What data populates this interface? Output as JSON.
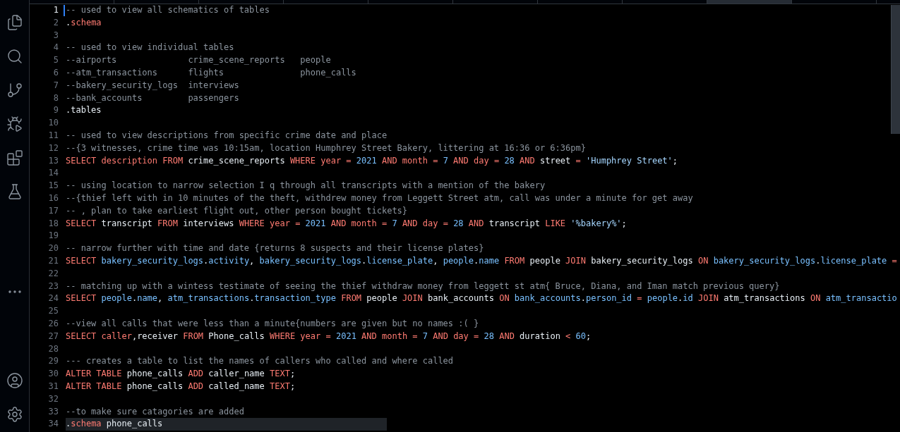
{
  "tabs": [
    {
      "selected": false
    },
    {
      "selected": false
    },
    {
      "selected": false
    },
    {
      "selected": false
    },
    {
      "selected": false
    },
    {
      "selected": false
    },
    {
      "selected": false
    },
    {
      "selected": false
    },
    {
      "selected": true
    },
    {
      "selected": false
    }
  ],
  "lines": [
    {
      "number": "1",
      "active": true,
      "tokens": [
        {
          "kind": "comment",
          "text": "-- used to view all schematics of tables"
        }
      ]
    },
    {
      "number": "2",
      "active": false,
      "tokens": [
        {
          "kind": "plain",
          "text": "."
        },
        {
          "kind": "keyword",
          "text": "schema"
        }
      ]
    },
    {
      "number": "3",
      "active": false
    },
    {
      "number": "4",
      "active": false,
      "tokens": [
        {
          "kind": "comment",
          "text": "-- used to view individual tables"
        }
      ]
    },
    {
      "number": "5",
      "active": false,
      "tokens": [
        {
          "kind": "comment",
          "text": "--airports              crime_scene_reports   people"
        }
      ]
    },
    {
      "number": "6",
      "active": false,
      "tokens": [
        {
          "kind": "comment",
          "text": "--atm_transactions      flights               phone_calls"
        }
      ]
    },
    {
      "number": "7",
      "active": false,
      "tokens": [
        {
          "kind": "comment",
          "text": "--bakery_security_logs  interviews"
        }
      ]
    },
    {
      "number": "8",
      "active": false,
      "tokens": [
        {
          "kind": "comment",
          "text": "--bank_accounts         passengers"
        }
      ]
    },
    {
      "number": "9",
      "active": false,
      "tokens": [
        {
          "kind": "plain",
          "text": ".tables"
        }
      ]
    },
    {
      "number": "10",
      "active": false
    },
    {
      "number": "11",
      "active": false,
      "tokens": [
        {
          "kind": "comment",
          "text": "-- used to view descriptions from specific crime date and place"
        }
      ]
    },
    {
      "number": "12",
      "active": false,
      "tokens": [
        {
          "kind": "comment",
          "text": "--{3 witnesses, crime time was 10:15am, location Humphrey Street Bakery, littering at 16:36 or 6:36pm}"
        }
      ]
    },
    {
      "number": "13",
      "active": false,
      "tokens": [
        {
          "kind": "keyword",
          "text": "SELECT description FROM "
        },
        {
          "kind": "plain",
          "text": "crime_scene_reports"
        },
        {
          "kind": "keyword",
          "text": " WHERE year = "
        },
        {
          "kind": "number",
          "text": "2021"
        },
        {
          "kind": "keyword",
          "text": " AND month = "
        },
        {
          "kind": "number",
          "text": "7"
        },
        {
          "kind": "keyword",
          "text": " AND day = "
        },
        {
          "kind": "number",
          "text": "28"
        },
        {
          "kind": "keyword",
          "text": " AND "
        },
        {
          "kind": "plain",
          "text": "street"
        },
        {
          "kind": "keyword",
          "text": " = "
        },
        {
          "kind": "string",
          "text": "'Humphrey Street'"
        },
        {
          "kind": "plain",
          "text": ";"
        }
      ]
    },
    {
      "number": "14",
      "active": false
    },
    {
      "number": "15",
      "active": false,
      "tokens": [
        {
          "kind": "comment",
          "text": "-- using location to narrow selection I q through all transcripts with a mention of the bakery"
        }
      ]
    },
    {
      "number": "16",
      "active": false,
      "tokens": [
        {
          "kind": "comment",
          "text": "--{thief left with in 10 minutes of the theft, withdrew money from Leggett Street atm, call was under a minute for get away"
        }
      ]
    },
    {
      "number": "17",
      "active": false,
      "tokens": [
        {
          "kind": "comment",
          "text": "-- , plan to take earliest flight out, other person bought tickets}"
        }
      ]
    },
    {
      "number": "18",
      "active": false,
      "tokens": [
        {
          "kind": "keyword",
          "text": "SELECT "
        },
        {
          "kind": "plain",
          "text": "transcript"
        },
        {
          "kind": "keyword",
          "text": " FROM "
        },
        {
          "kind": "plain",
          "text": "interviews"
        },
        {
          "kind": "keyword",
          "text": " WHERE year = "
        },
        {
          "kind": "number",
          "text": "2021"
        },
        {
          "kind": "keyword",
          "text": " AND month = "
        },
        {
          "kind": "number",
          "text": "7"
        },
        {
          "kind": "keyword",
          "text": " AND day = "
        },
        {
          "kind": "number",
          "text": "28"
        },
        {
          "kind": "keyword",
          "text": " AND "
        },
        {
          "kind": "plain",
          "text": "transcript"
        },
        {
          "kind": "keyword",
          "text": " LIKE "
        },
        {
          "kind": "string",
          "text": "'%bakery%'"
        },
        {
          "kind": "plain",
          "text": ";"
        }
      ]
    },
    {
      "number": "19",
      "active": false
    },
    {
      "number": "20",
      "active": false,
      "tokens": [
        {
          "kind": "comment",
          "text": "-- narrow further with time and date {returns 8 suspects and their license plates}"
        }
      ]
    },
    {
      "number": "21",
      "active": false,
      "tokens": [
        {
          "kind": "keyword",
          "text": "SELECT "
        },
        {
          "kind": "member",
          "text": "bakery_security_logs"
        },
        {
          "kind": "plain",
          "text": "."
        },
        {
          "kind": "member",
          "text": "activity"
        },
        {
          "kind": "plain",
          "text": ", "
        },
        {
          "kind": "member",
          "text": "bakery_security_logs"
        },
        {
          "kind": "plain",
          "text": "."
        },
        {
          "kind": "member",
          "text": "license_plate"
        },
        {
          "kind": "plain",
          "text": ", "
        },
        {
          "kind": "member",
          "text": "people"
        },
        {
          "kind": "plain",
          "text": "."
        },
        {
          "kind": "member",
          "text": "name"
        },
        {
          "kind": "keyword",
          "text": " FROM "
        },
        {
          "kind": "plain",
          "text": "people"
        },
        {
          "kind": "keyword",
          "text": " JOIN "
        },
        {
          "kind": "plain",
          "text": "bakery_security_logs"
        },
        {
          "kind": "keyword",
          "text": " ON "
        },
        {
          "kind": "member",
          "text": "bakery_security_logs"
        },
        {
          "kind": "plain",
          "text": "."
        },
        {
          "kind": "member",
          "text": "license_plate"
        },
        {
          "kind": "keyword",
          "text": " ="
        }
      ]
    },
    {
      "number": "22",
      "active": false
    },
    {
      "number": "23",
      "active": false,
      "tokens": [
        {
          "kind": "comment",
          "text": "-- matching up with a wintess testimate of seeing the thief withdraw money from leggett st atm{ Bruce, Diana, and Iman match previous query}"
        }
      ]
    },
    {
      "number": "24",
      "active": false,
      "tokens": [
        {
          "kind": "keyword",
          "text": "SELECT "
        },
        {
          "kind": "member",
          "text": "people"
        },
        {
          "kind": "plain",
          "text": "."
        },
        {
          "kind": "member",
          "text": "name"
        },
        {
          "kind": "plain",
          "text": ", "
        },
        {
          "kind": "member",
          "text": "atm_transactions"
        },
        {
          "kind": "plain",
          "text": "."
        },
        {
          "kind": "member",
          "text": "transaction_type"
        },
        {
          "kind": "keyword",
          "text": " FROM "
        },
        {
          "kind": "plain",
          "text": "people"
        },
        {
          "kind": "keyword",
          "text": " JOIN "
        },
        {
          "kind": "plain",
          "text": "bank_accounts"
        },
        {
          "kind": "keyword",
          "text": " ON "
        },
        {
          "kind": "member",
          "text": "bank_accounts"
        },
        {
          "kind": "plain",
          "text": "."
        },
        {
          "kind": "member",
          "text": "person_id"
        },
        {
          "kind": "keyword",
          "text": " = "
        },
        {
          "kind": "member",
          "text": "people"
        },
        {
          "kind": "plain",
          "text": "."
        },
        {
          "kind": "member",
          "text": "id"
        },
        {
          "kind": "keyword",
          "text": " JOIN "
        },
        {
          "kind": "plain",
          "text": "atm_transactions"
        },
        {
          "kind": "keyword",
          "text": " ON "
        },
        {
          "kind": "member",
          "text": "atm_transactio"
        }
      ]
    },
    {
      "number": "25",
      "active": false
    },
    {
      "number": "26",
      "active": false,
      "tokens": [
        {
          "kind": "comment",
          "text": "--view all calls that were less than a minute{numbers are given but no names :( }"
        }
      ]
    },
    {
      "number": "27",
      "active": false,
      "tokens": [
        {
          "kind": "keyword",
          "text": "SELECT caller"
        },
        {
          "kind": "plain",
          "text": ",receiver"
        },
        {
          "kind": "keyword",
          "text": " FROM "
        },
        {
          "kind": "plain",
          "text": "Phone_calls"
        },
        {
          "kind": "keyword",
          "text": " WHERE year = "
        },
        {
          "kind": "number",
          "text": "2021"
        },
        {
          "kind": "keyword",
          "text": " AND month = "
        },
        {
          "kind": "number",
          "text": "7"
        },
        {
          "kind": "keyword",
          "text": " AND day = "
        },
        {
          "kind": "number",
          "text": "28"
        },
        {
          "kind": "keyword",
          "text": " AND "
        },
        {
          "kind": "plain",
          "text": "duration"
        },
        {
          "kind": "keyword",
          "text": " < "
        },
        {
          "kind": "number",
          "text": "60"
        },
        {
          "kind": "plain",
          "text": ";"
        }
      ]
    },
    {
      "number": "28",
      "active": false
    },
    {
      "number": "29",
      "active": false,
      "tokens": [
        {
          "kind": "comment",
          "text": "--- creates a table to list the names of callers who called and where called"
        }
      ]
    },
    {
      "number": "30",
      "active": false,
      "tokens": [
        {
          "kind": "keyword",
          "text": "ALTER TABLE "
        },
        {
          "kind": "plain",
          "text": "phone_calls"
        },
        {
          "kind": "keyword",
          "text": " ADD "
        },
        {
          "kind": "plain",
          "text": "caller_name"
        },
        {
          "kind": "keyword",
          "text": " TEXT"
        },
        {
          "kind": "plain",
          "text": ";"
        }
      ]
    },
    {
      "number": "31",
      "active": false,
      "tokens": [
        {
          "kind": "keyword",
          "text": "ALTER TABLE "
        },
        {
          "kind": "plain",
          "text": "phone_calls"
        },
        {
          "kind": "keyword",
          "text": " ADD "
        },
        {
          "kind": "plain",
          "text": "called_name"
        },
        {
          "kind": "keyword",
          "text": " TEXT"
        },
        {
          "kind": "plain",
          "text": ";"
        }
      ]
    },
    {
      "number": "32",
      "active": false
    },
    {
      "number": "33",
      "active": false,
      "tokens": [
        {
          "kind": "comment",
          "text": "--to make sure catagories are added"
        }
      ]
    },
    {
      "number": "34",
      "active": false,
      "highlighted": true,
      "tokens": [
        {
          "kind": "plain",
          "text": "."
        },
        {
          "kind": "keyword",
          "text": "schema"
        },
        {
          "kind": "plain",
          "text": " phone_calls"
        }
      ]
    }
  ]
}
